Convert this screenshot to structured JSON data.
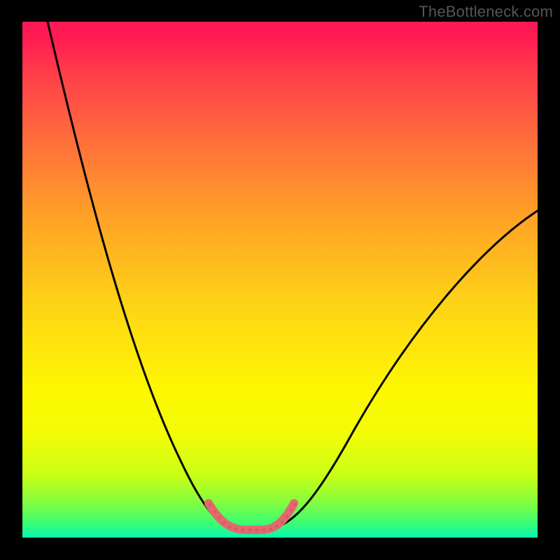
{
  "watermark": "TheBottleneck.com",
  "chart_data": {
    "type": "line",
    "title": "",
    "xlabel": "",
    "ylabel": "",
    "xlim": [
      0,
      100
    ],
    "ylim": [
      0,
      100
    ],
    "grid": false,
    "background": {
      "type": "vertical-gradient",
      "stops": [
        {
          "pos": 0,
          "color": "#ff1a53"
        },
        {
          "pos": 10,
          "color": "#ff3e4a"
        },
        {
          "pos": 23,
          "color": "#ff6e3b"
        },
        {
          "pos": 38,
          "color": "#ffa226"
        },
        {
          "pos": 55,
          "color": "#fed416"
        },
        {
          "pos": 72,
          "color": "#fdf801"
        },
        {
          "pos": 80,
          "color": "#f2fd06"
        },
        {
          "pos": 88,
          "color": "#c8fe17"
        },
        {
          "pos": 93,
          "color": "#86fd3d"
        },
        {
          "pos": 97,
          "color": "#3ffd70"
        },
        {
          "pos": 100,
          "color": "#07f8b0"
        }
      ]
    },
    "series": [
      {
        "name": "bottleneck-curve",
        "color": "#000000",
        "x": [
          5,
          10,
          15,
          20,
          25,
          30,
          35,
          37,
          40,
          42,
          44,
          46,
          48,
          50,
          52,
          55,
          60,
          70,
          80,
          90,
          100
        ],
        "y": [
          100,
          80,
          62,
          47,
          34,
          22,
          12,
          8,
          3,
          1.5,
          1,
          1,
          1,
          1.5,
          3,
          8,
          18,
          35,
          48,
          57,
          64
        ]
      }
    ],
    "annotations": [
      {
        "name": "highlighted-minimum",
        "type": "segment-highlight",
        "color": "#e26a6f",
        "x_range": [
          36,
          53
        ],
        "note": "dotted pink thick stroke over curve valley"
      }
    ]
  }
}
